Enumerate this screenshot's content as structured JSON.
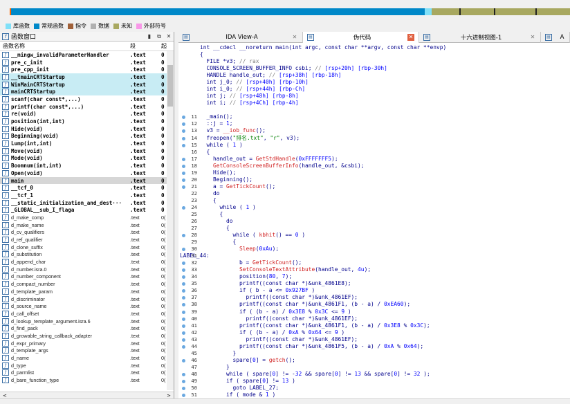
{
  "legend": [
    {
      "label": "库函数",
      "color": "#80e0f8"
    },
    {
      "label": "常规函数",
      "color": "#0088c8"
    },
    {
      "label": "指令",
      "color": "#a06038"
    },
    {
      "label": "数据",
      "color": "#b0b0b0"
    },
    {
      "label": "未知",
      "color": "#a8a860"
    },
    {
      "label": "外部符号",
      "color": "#f898e8"
    }
  ],
  "functions_window": {
    "title": "函数窗口",
    "col_name": "函数名称",
    "col_segment": "段",
    "col_start": "起",
    "rows": [
      {
        "name": "__mingw_invalidParameterHandler",
        "seg": ".text",
        "off": "0",
        "style": "lib"
      },
      {
        "name": "pre_c_init",
        "seg": ".text",
        "off": "0",
        "style": "lib"
      },
      {
        "name": "pre_cpp_init",
        "seg": ".text",
        "off": "0",
        "style": "lib"
      },
      {
        "name": "__tmainCRTStartup",
        "seg": ".text",
        "off": "0",
        "style": "lib hl"
      },
      {
        "name": "WinMainCRTStartup",
        "seg": ".text",
        "off": "0",
        "style": "lib hl"
      },
      {
        "name": "mainCRTStartup",
        "seg": ".text",
        "off": "0",
        "style": "lib hl"
      },
      {
        "name": "scanf(char const*,...)",
        "seg": ".text",
        "off": "0",
        "style": "lib"
      },
      {
        "name": "printf(char const*,...)",
        "seg": ".text",
        "off": "0",
        "style": "lib"
      },
      {
        "name": "re(void)",
        "seg": ".text",
        "off": "0",
        "style": "lib"
      },
      {
        "name": "position(int,int)",
        "seg": ".text",
        "off": "0",
        "style": "lib"
      },
      {
        "name": "Hide(void)",
        "seg": ".text",
        "off": "0",
        "style": "lib"
      },
      {
        "name": "Beginning(void)",
        "seg": ".text",
        "off": "0",
        "style": "lib"
      },
      {
        "name": "Lump(int,int)",
        "seg": ".text",
        "off": "0",
        "style": "lib"
      },
      {
        "name": "Move(void)",
        "seg": ".text",
        "off": "0",
        "style": "lib"
      },
      {
        "name": "Mode(void)",
        "seg": ".text",
        "off": "0",
        "style": "lib"
      },
      {
        "name": "Boomnum(int,int)",
        "seg": ".text",
        "off": "0",
        "style": "lib"
      },
      {
        "name": "Open(void)",
        "seg": ".text",
        "off": "0",
        "style": "lib"
      },
      {
        "name": "main",
        "seg": ".text",
        "off": "0",
        "style": "lib cur"
      },
      {
        "name": "__tcf_0",
        "seg": ".text",
        "off": "0",
        "style": "lib"
      },
      {
        "name": "__tcf_1",
        "seg": ".text",
        "off": "0",
        "style": "lib"
      },
      {
        "name": "__static_initialization_and_dest···",
        "seg": ".text",
        "off": "0",
        "style": "lib"
      },
      {
        "name": "_GLOBAL__sub_I_flaga",
        "seg": ".text",
        "off": "0",
        "style": "lib"
      },
      {
        "name": "d_make_comp",
        "seg": ".text",
        "off": "0(",
        "style": "norm"
      },
      {
        "name": "d_make_name",
        "seg": ".text",
        "off": "0(",
        "style": "norm"
      },
      {
        "name": "d_cv_qualifiers",
        "seg": ".text",
        "off": "0(",
        "style": "norm"
      },
      {
        "name": "d_ref_qualifier",
        "seg": ".text",
        "off": "0(",
        "style": "norm"
      },
      {
        "name": "d_clone_suffix",
        "seg": ".text",
        "off": "0(",
        "style": "norm"
      },
      {
        "name": "d_substitution",
        "seg": ".text",
        "off": "0(",
        "style": "norm"
      },
      {
        "name": "d_append_char",
        "seg": ".text",
        "off": "0(",
        "style": "norm"
      },
      {
        "name": "d_number.isra.0",
        "seg": ".text",
        "off": "0(",
        "style": "norm"
      },
      {
        "name": "d_number_component",
        "seg": ".text",
        "off": "0(",
        "style": "norm"
      },
      {
        "name": "d_compact_number",
        "seg": ".text",
        "off": "0(",
        "style": "norm"
      },
      {
        "name": "d_template_param",
        "seg": ".text",
        "off": "0(",
        "style": "norm"
      },
      {
        "name": "d_discriminator",
        "seg": ".text",
        "off": "0(",
        "style": "norm"
      },
      {
        "name": "d_source_name",
        "seg": ".text",
        "off": "0(",
        "style": "norm"
      },
      {
        "name": "d_call_offset",
        "seg": ".text",
        "off": "0(",
        "style": "norm"
      },
      {
        "name": "d_lookup_template_argument.isra.6",
        "seg": ".text",
        "off": "0(",
        "style": "norm"
      },
      {
        "name": "d_find_pack",
        "seg": ".text",
        "off": "0(",
        "style": "norm"
      },
      {
        "name": "d_growable_string_callback_adapter",
        "seg": ".text",
        "off": "0(",
        "style": "norm"
      },
      {
        "name": "d_expr_primary",
        "seg": ".text",
        "off": "0(",
        "style": "norm"
      },
      {
        "name": "d_template_args",
        "seg": ".text",
        "off": "0(",
        "style": "norm"
      },
      {
        "name": "d_name",
        "seg": ".text",
        "off": "0(",
        "style": "norm"
      },
      {
        "name": "d_type",
        "seg": ".text",
        "off": "0(",
        "style": "norm"
      },
      {
        "name": "d_parmlist",
        "seg": ".text",
        "off": "0(",
        "style": "norm"
      },
      {
        "name": "d_bare_function_type",
        "seg": ".text",
        "off": "0(",
        "style": "norm"
      }
    ]
  },
  "tabs": [
    {
      "label": "IDA View-A",
      "icon": "ida-view-icon",
      "active": false
    },
    {
      "label": "伪代码",
      "icon": "pseudocode-icon",
      "active": true
    },
    {
      "label": "十六进制视图-1",
      "icon": "hex-view-icon",
      "active": false
    },
    {
      "label": "A",
      "icon": "structures-icon",
      "active": false
    }
  ],
  "code_lines": [
    {
      "n": "",
      "dot": false,
      "text": "int __cdecl __noreturn main(int argc, const char **argv, const char **envp)"
    },
    {
      "n": "",
      "dot": false,
      "text": "{"
    },
    {
      "n": "",
      "dot": false,
      "text": "  FILE *v3; // rax"
    },
    {
      "n": "",
      "dot": false,
      "text": "  CONSOLE_SCREEN_BUFFER_INFO csbi; // [rsp+20h] [rbp-30h]"
    },
    {
      "n": "",
      "dot": false,
      "text": "  HANDLE handle_out; // [rsp+38h] [rbp-18h]"
    },
    {
      "n": "",
      "dot": false,
      "text": "  int j_0; // [rsp+40h] [rbp-10h]"
    },
    {
      "n": "",
      "dot": false,
      "text": "  int i_0; // [rsp+44h] [rbp-Ch]"
    },
    {
      "n": "",
      "dot": false,
      "text": "  int j; // [rsp+48h] [rbp-8h]"
    },
    {
      "n": "",
      "dot": false,
      "text": "  int i; // [rsp+4Ch] [rbp-4h]"
    },
    {
      "n": "",
      "dot": false,
      "text": ""
    },
    {
      "n": "11",
      "dot": true,
      "text": "  _main();"
    },
    {
      "n": "12",
      "dot": true,
      "text": "  ::j = 1;"
    },
    {
      "n": "13",
      "dot": true,
      "text": "  v3 = __iob_func();"
    },
    {
      "n": "14",
      "dot": true,
      "text": "  freopen(\"排名.txt\", \"r\", v3);"
    },
    {
      "n": "15",
      "dot": true,
      "text": "  while ( 1 )"
    },
    {
      "n": "16",
      "dot": false,
      "text": "  {"
    },
    {
      "n": "17",
      "dot": true,
      "text": "    handle_out = GetStdHandle(0xFFFFFFF5);"
    },
    {
      "n": "18",
      "dot": true,
      "text": "    GetConsoleScreenBufferInfo(handle_out, &csbi);"
    },
    {
      "n": "19",
      "dot": true,
      "text": "    Hide();"
    },
    {
      "n": "20",
      "dot": true,
      "text": "    Beginning();"
    },
    {
      "n": "21",
      "dot": true,
      "text": "    a = GetTickCount();"
    },
    {
      "n": "22",
      "dot": false,
      "text": "    do"
    },
    {
      "n": "23",
      "dot": false,
      "text": "    {"
    },
    {
      "n": "24",
      "dot": true,
      "text": "      while ( 1 )"
    },
    {
      "n": "25",
      "dot": false,
      "text": "      {"
    },
    {
      "n": "26",
      "dot": false,
      "text": "        do"
    },
    {
      "n": "27",
      "dot": false,
      "text": "        {"
    },
    {
      "n": "28",
      "dot": true,
      "text": "          while ( kbhit() == 0 )"
    },
    {
      "n": "29",
      "dot": false,
      "text": "          {"
    },
    {
      "n": "30",
      "dot": true,
      "text": "            Sleep(0xAu);"
    },
    {
      "n": "31",
      "dot": false,
      "label": true,
      "text": "LABEL_44:"
    },
    {
      "n": "32",
      "dot": true,
      "text": "            b = GetTickCount();"
    },
    {
      "n": "33",
      "dot": true,
      "text": "            SetConsoleTextAttribute(handle_out, 4u);"
    },
    {
      "n": "34",
      "dot": true,
      "text": "            position(80, 7);"
    },
    {
      "n": "35",
      "dot": true,
      "text": "            printf((const char *)&unk_4861E8);"
    },
    {
      "n": "36",
      "dot": true,
      "text": "            if ( b - a <= 0x927BF )"
    },
    {
      "n": "37",
      "dot": true,
      "text": "              printf((const char *)&unk_4861EF);"
    },
    {
      "n": "38",
      "dot": true,
      "text": "            printf((const char *)&unk_4861F1, (b - a) / 0xEA60);"
    },
    {
      "n": "39",
      "dot": true,
      "text": "            if ( (b - a) / 0x3E8 % 0x3C <= 9 )"
    },
    {
      "n": "40",
      "dot": true,
      "text": "              printf((const char *)&unk_4861EF);"
    },
    {
      "n": "41",
      "dot": true,
      "text": "            printf((const char *)&unk_4861F1, (b - a) / 0x3E8 % 0x3C);"
    },
    {
      "n": "42",
      "dot": true,
      "text": "            if ( (b - a) / 0xA % 0x64 <= 9 )"
    },
    {
      "n": "43",
      "dot": true,
      "text": "              printf((const char *)&unk_4861EF);"
    },
    {
      "n": "44",
      "dot": true,
      "text": "            printf((const char *)&unk_4861F5, (b - a) / 0xA % 0x64);"
    },
    {
      "n": "45",
      "dot": false,
      "text": "          }"
    },
    {
      "n": "46",
      "dot": true,
      "text": "          spare[0] = getch();"
    },
    {
      "n": "47",
      "dot": false,
      "text": "        }"
    },
    {
      "n": "48",
      "dot": true,
      "text": "        while ( spare[0] != -32 && spare[0] != 13 && spare[0] != 32 );"
    },
    {
      "n": "49",
      "dot": true,
      "text": "        if ( spare[0] != 13 )"
    },
    {
      "n": "50",
      "dot": true,
      "text": "          goto LABEL_27;"
    },
    {
      "n": "51",
      "dot": true,
      "text": "        if ( mode & 1 )"
    }
  ]
}
